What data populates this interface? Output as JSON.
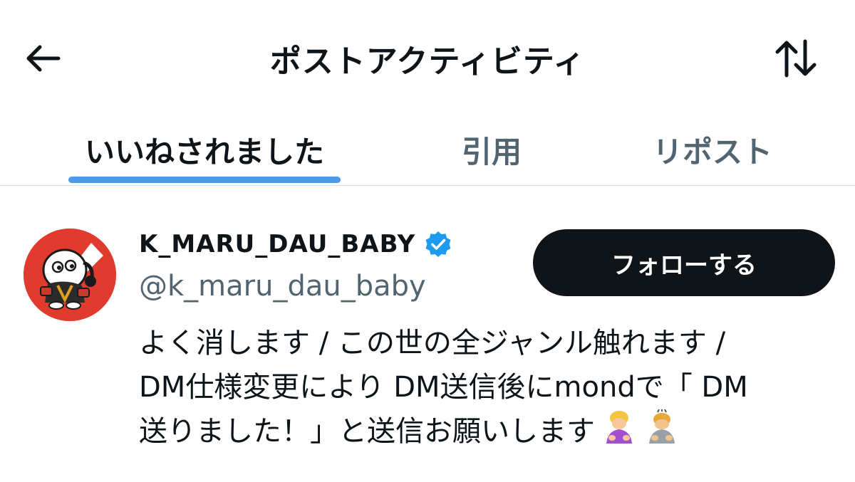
{
  "header": {
    "title": "ポストアクティビティ",
    "back_icon": "arrow-left-icon",
    "sort_icon": "sort-arrows-icon"
  },
  "tabs": [
    {
      "label": "いいねされました",
      "active": true
    },
    {
      "label": "引用",
      "active": false
    },
    {
      "label": "リポスト",
      "active": false
    }
  ],
  "colors": {
    "accent": "#4d9be8",
    "text_primary": "#0f1419",
    "text_secondary": "#536471",
    "follow_bg": "#0f1419",
    "verified": "#1d9bf0",
    "avatar_bg": "#e13a2e"
  },
  "user": {
    "display_name": "K_MARU_DAU_BABY",
    "verified": true,
    "handle": "@k_maru_dau_baby",
    "follow_label": "フォローする",
    "bio_lines": [
      "よく消します / この世の全ジャンル触れます /",
      "DM仕様変更により DM送信後にmondで「 DM",
      "送りました！」と送信お願いします"
    ],
    "bio_emojis": [
      "woman-bowing-emoji",
      "person-bowing-emoji"
    ]
  }
}
